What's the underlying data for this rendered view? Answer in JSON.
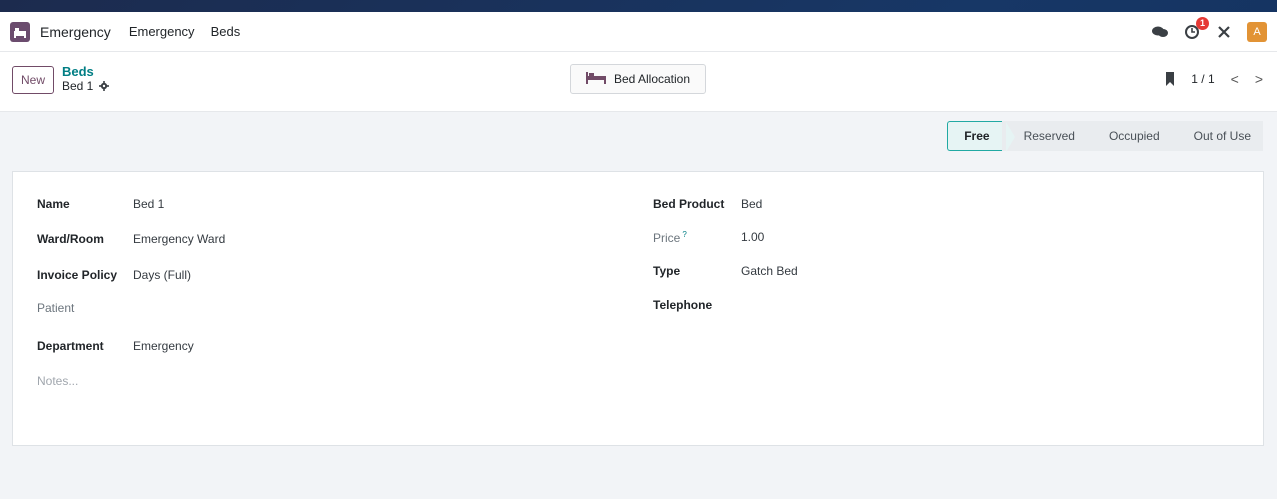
{
  "navbar": {
    "app_name": "Emergency",
    "menu_items": [
      "Emergency",
      "Beds"
    ],
    "activity_badge": "1",
    "avatar_letter": "A",
    "icons": [
      "chat-icon",
      "activity-clock-icon",
      "debug-tools-icon"
    ]
  },
  "control": {
    "new_label": "New",
    "breadcrumb_parent": "Beds",
    "breadcrumb_current": "Bed 1",
    "allocation_label": "Bed Allocation",
    "pager_text": "1 / 1",
    "prev": "<",
    "next": ">"
  },
  "status": {
    "stages": [
      "Free",
      "Reserved",
      "Occupied",
      "Out of Use"
    ],
    "active": "Free"
  },
  "form": {
    "left": [
      {
        "label": "Name",
        "value": "Bed 1"
      },
      {
        "label": "Ward/Room",
        "value": "Emergency Ward"
      },
      {
        "label": "Invoice Policy",
        "value": "Days (Full)"
      },
      {
        "label": "Patient",
        "value": ""
      },
      {
        "label": "Department",
        "value": "Emergency"
      }
    ],
    "notes_placeholder": "Notes...",
    "right": [
      {
        "label": "Bed Product",
        "value": "Bed"
      },
      {
        "label": "Price",
        "value": "1.00",
        "help": "?"
      },
      {
        "label": "Type",
        "value": "Gatch Bed"
      },
      {
        "label": "Telephone",
        "value": ""
      }
    ]
  },
  "colors": {
    "brand": "#714b67",
    "link": "#017e84",
    "active_stage_border": "#21a9a3",
    "badge": "#e53935",
    "avatar": "#e29335"
  }
}
